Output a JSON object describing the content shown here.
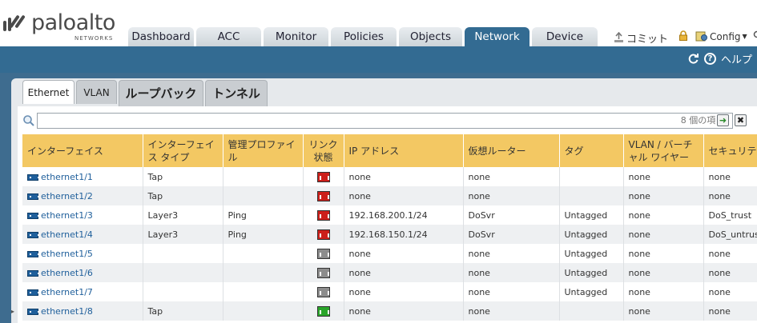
{
  "app": {
    "brand": "paloalto",
    "brand_sub": "NETWORKS",
    "accent": "#336b92"
  },
  "nav": {
    "tabs": [
      {
        "label": "Dashboard",
        "active": false
      },
      {
        "label": "ACC",
        "active": false
      },
      {
        "label": "Monitor",
        "active": false
      },
      {
        "label": "Policies",
        "active": false
      },
      {
        "label": "Objects",
        "active": false
      },
      {
        "label": "Network",
        "active": true
      },
      {
        "label": "Device",
        "active": false
      }
    ]
  },
  "toolbar": {
    "commit_label": "コミット",
    "config_label": "Config",
    "help_label": "ヘルプ"
  },
  "subtabs": [
    {
      "label": "Ethernet",
      "active": true
    },
    {
      "label": "VLAN",
      "active": false
    },
    {
      "label": "ループバック",
      "active": false
    },
    {
      "label": "トンネル",
      "active": false
    }
  ],
  "filter": {
    "value": "",
    "count_text": "8 個の項目s"
  },
  "table": {
    "columns": [
      "インターフェイス",
      "インターフェイス タイプ",
      "管理プロファイル",
      "リンク 状態",
      "IP アドレス",
      "仮想ルーター",
      "タグ",
      "VLAN / バーチャル ワイヤー",
      "セキュリティ"
    ],
    "rows": [
      {
        "name": "ethernet1/1",
        "type": "Tap",
        "profile": "",
        "link": "red",
        "ip": "none",
        "router": "none",
        "tag": "",
        "vlan": "none",
        "zone": "none"
      },
      {
        "name": "ethernet1/2",
        "type": "Tap",
        "profile": "",
        "link": "red",
        "ip": "none",
        "router": "none",
        "tag": "",
        "vlan": "none",
        "zone": "none"
      },
      {
        "name": "ethernet1/3",
        "type": "Layer3",
        "profile": "Ping",
        "link": "red",
        "ip": "192.168.200.1/24",
        "router": "DoSvr",
        "tag": "Untagged",
        "vlan": "none",
        "zone": "DoS_trust"
      },
      {
        "name": "ethernet1/4",
        "type": "Layer3",
        "profile": "Ping",
        "link": "red",
        "ip": "192.168.150.1/24",
        "router": "DoSvr",
        "tag": "Untagged",
        "vlan": "none",
        "zone": "DoS_untrust"
      },
      {
        "name": "ethernet1/5",
        "type": "",
        "profile": "",
        "link": "gray",
        "ip": "none",
        "router": "none",
        "tag": "Untagged",
        "vlan": "none",
        "zone": "none"
      },
      {
        "name": "ethernet1/6",
        "type": "",
        "profile": "",
        "link": "gray",
        "ip": "none",
        "router": "none",
        "tag": "Untagged",
        "vlan": "none",
        "zone": "none"
      },
      {
        "name": "ethernet1/7",
        "type": "",
        "profile": "",
        "link": "gray",
        "ip": "none",
        "router": "none",
        "tag": "Untagged",
        "vlan": "none",
        "zone": "none"
      },
      {
        "name": "ethernet1/8",
        "type": "Tap",
        "profile": "",
        "link": "green",
        "ip": "none",
        "router": "none",
        "tag": "",
        "vlan": "none",
        "zone": "none"
      }
    ]
  },
  "colors": {
    "link_red": "#cc1f1a",
    "link_gray": "#8c8c8c",
    "link_green": "#2aa52a",
    "header_yellow": "#f3c863"
  }
}
